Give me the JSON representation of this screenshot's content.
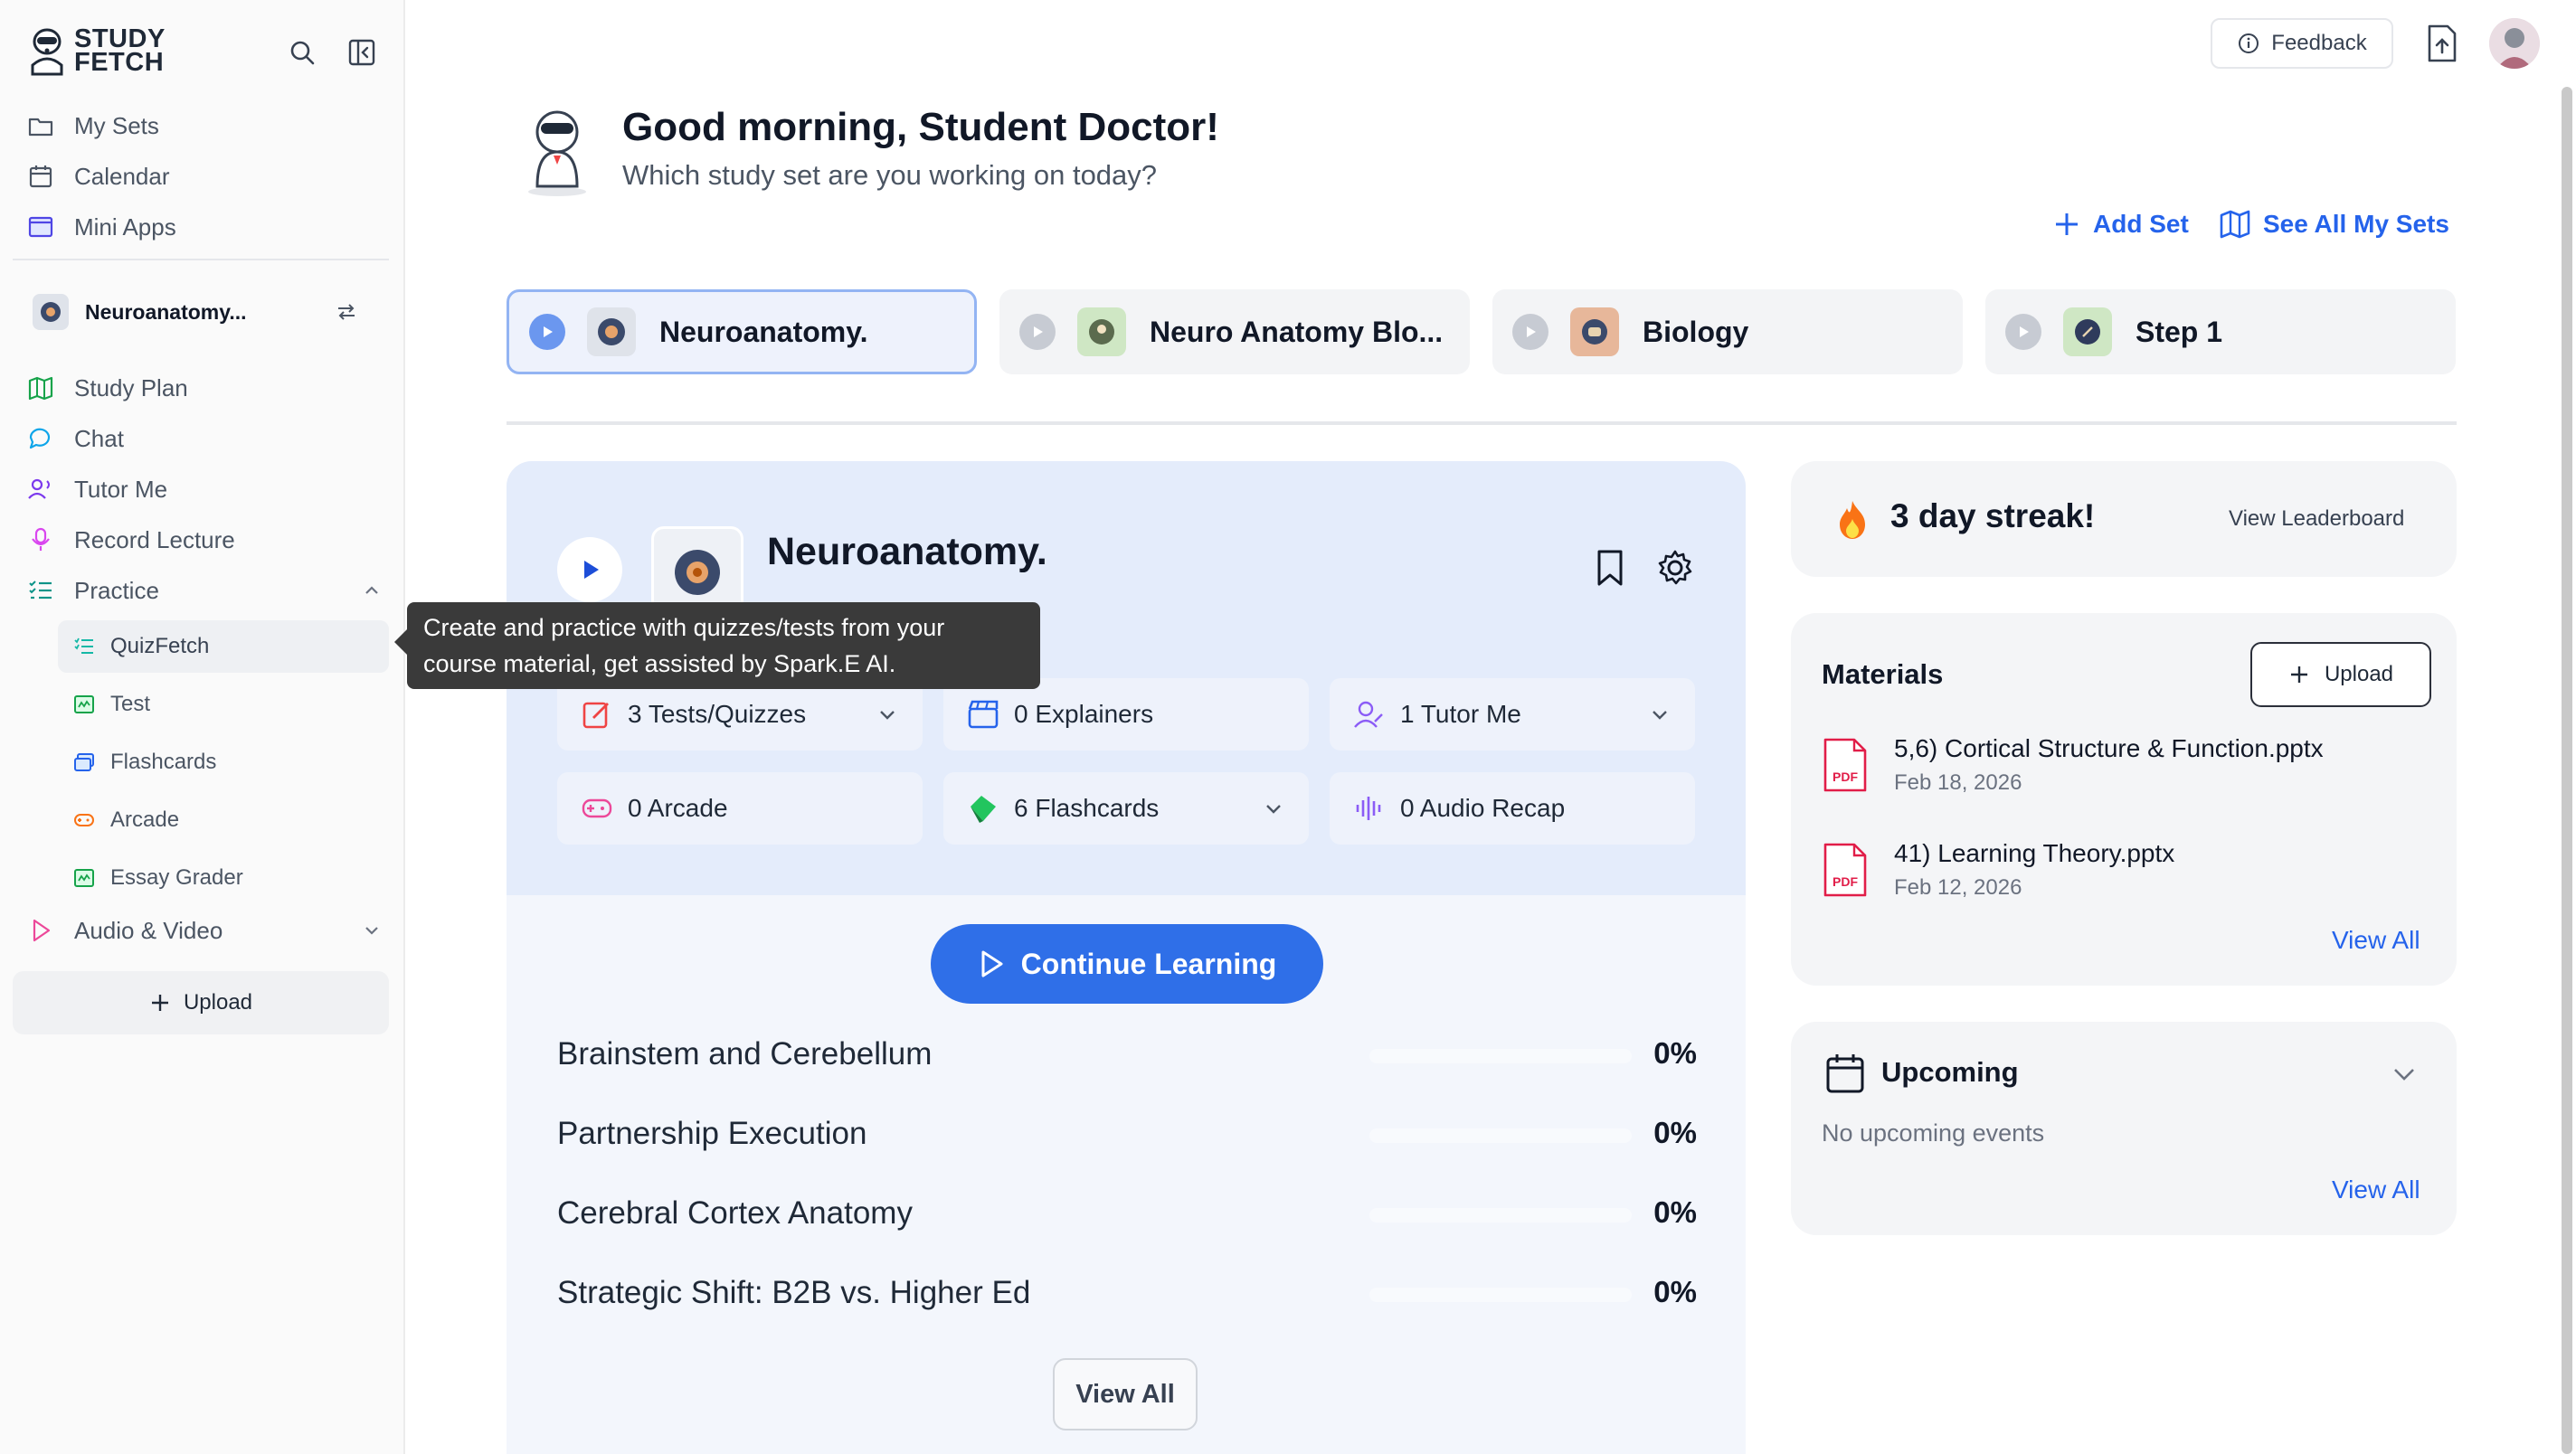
{
  "brand": {
    "logo_line1": "STUDY",
    "logo_line2": "FETCH"
  },
  "sidebar": {
    "top_items": [
      {
        "label": "My Sets",
        "icon": "folder-icon"
      },
      {
        "label": "Calendar",
        "icon": "calendar-icon"
      },
      {
        "label": "Mini Apps",
        "icon": "window-icon"
      }
    ],
    "current_set": "Neuroanatomy...",
    "set_items": [
      {
        "label": "Study Plan",
        "icon": "map-icon"
      },
      {
        "label": "Chat",
        "icon": "chat-icon"
      },
      {
        "label": "Tutor Me",
        "icon": "tutor-icon"
      },
      {
        "label": "Record Lecture",
        "icon": "microphone-icon"
      },
      {
        "label": "Practice",
        "icon": "checklist-icon"
      }
    ],
    "practice_items": [
      {
        "label": "QuizFetch",
        "icon": "checklist-icon"
      },
      {
        "label": "Test",
        "icon": "test-icon"
      },
      {
        "label": "Flashcards",
        "icon": "flashcards-icon"
      },
      {
        "label": "Arcade",
        "icon": "gamepad-icon"
      },
      {
        "label": "Essay Grader",
        "icon": "essay-icon"
      }
    ],
    "audio_video": "Audio & Video",
    "upload": "Upload"
  },
  "topbar": {
    "feedback": "Feedback"
  },
  "greeting": {
    "title": "Good morning, Student Doctor!",
    "subtitle": "Which study set are you working on today?"
  },
  "actions": {
    "add_set": "Add Set",
    "see_all_sets": "See All My Sets"
  },
  "set_tabs": [
    {
      "label": "Neuroanatomy.",
      "thumb_color": "#dfe3ea"
    },
    {
      "label": "Neuro Anatomy Blo...",
      "thumb_color": "#cfe7c4"
    },
    {
      "label": "Biology",
      "thumb_color": "#e7b79a"
    },
    {
      "label": "Step 1",
      "thumb_color": "#cfe7c4"
    }
  ],
  "study_set": {
    "title": "Neuroanatomy.",
    "stats": [
      {
        "label": "3 Tests/Quizzes",
        "has_dropdown": true
      },
      {
        "label": "0 Explainers",
        "has_dropdown": false
      },
      {
        "label": "1 Tutor Me",
        "has_dropdown": true
      },
      {
        "label": "0 Arcade",
        "has_dropdown": false
      },
      {
        "label": "6 Flashcards",
        "has_dropdown": true
      },
      {
        "label": "0 Audio Recap",
        "has_dropdown": false
      }
    ],
    "continue_label": "Continue Learning",
    "topics": [
      {
        "name": "Brainstem and Cerebellum",
        "progress": "0%"
      },
      {
        "name": "Partnership Execution",
        "progress": "0%"
      },
      {
        "name": "Cerebral Cortex Anatomy",
        "progress": "0%"
      },
      {
        "name": "Strategic Shift: B2B vs. Higher Ed",
        "progress": "0%"
      }
    ],
    "view_all": "View All"
  },
  "tooltip": {
    "line1": "Create and practice with quizzes/tests from your",
    "line2": "course material, get assisted by Spark.E AI."
  },
  "streak": {
    "label": "3 day streak!",
    "leaderboard": "View Leaderboard"
  },
  "materials": {
    "title": "Materials",
    "upload": "Upload",
    "file_badge": "PDF",
    "items": [
      {
        "name": "5,6) Cortical Structure & Function.pptx",
        "date": "Feb 18, 2026"
      },
      {
        "name": "41) Learning Theory.pptx",
        "date": "Feb 12, 2026"
      }
    ],
    "view_all": "View All"
  },
  "upcoming": {
    "title": "Upcoming",
    "empty": "No upcoming events",
    "view_all": "View All"
  },
  "colors": {
    "accent": "#2f6fe8",
    "link": "#2563eb",
    "tooltip_bg": "#3a3a3a"
  }
}
